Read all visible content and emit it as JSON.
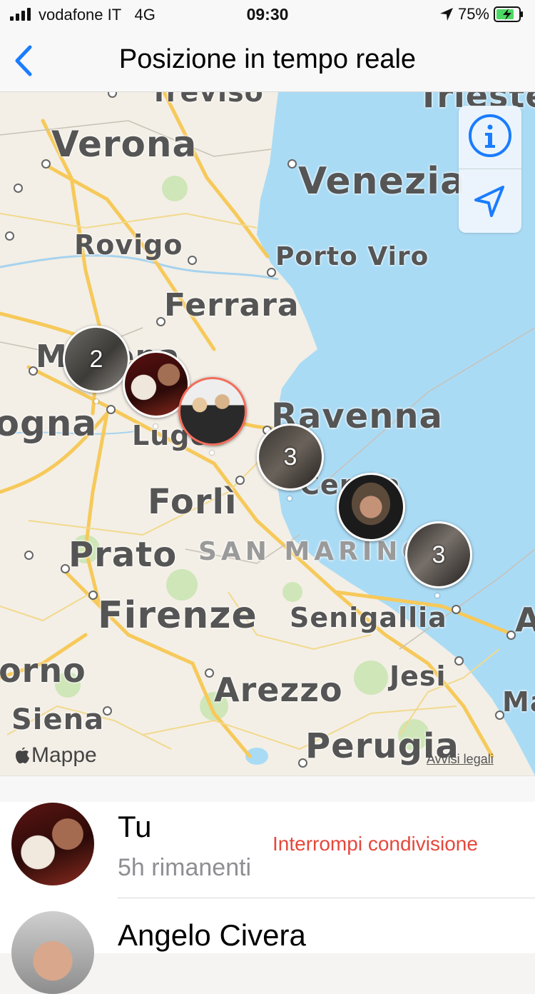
{
  "status": {
    "carrier": "vodafone IT",
    "network": "4G",
    "time": "09:30",
    "battery": "75%",
    "icons": [
      "signal-bars-icon",
      "location-arrow-icon",
      "battery-charging-icon"
    ]
  },
  "header": {
    "title": "Posizione in tempo reale",
    "back_icon": "chevron-left-icon"
  },
  "map": {
    "cities": [
      "Treviso",
      "Trieste",
      "Verona",
      "Venezia",
      "Rovigo",
      "Porto Viro",
      "Ferrara",
      "Modena",
      "Bologna",
      "Lugo",
      "Ravenna",
      "Cervia",
      "Forlì",
      "Prato",
      "SAN MARINO",
      "Firenze",
      "Senigallia",
      "Livorno",
      "Arezzo",
      "Jesi",
      "Siena",
      "Perugia",
      "Macerata",
      "Ancona"
    ],
    "clusters": [
      {
        "label": "2",
        "kind": "group"
      },
      {
        "label": "",
        "kind": "person"
      },
      {
        "label": "",
        "kind": "person"
      },
      {
        "label": "3",
        "kind": "group"
      },
      {
        "label": "",
        "kind": "person"
      },
      {
        "label": "3",
        "kind": "group"
      }
    ],
    "controls": [
      "info-icon",
      "location-arrow-icon"
    ],
    "brand": "Mappe",
    "legal": "Avvisi legali"
  },
  "people": [
    {
      "name": "Tu",
      "subtitle": "5h rimanenti",
      "action": "Interrompi condivisione"
    },
    {
      "name": "Angelo Civera"
    }
  ],
  "colors": {
    "accent": "#1a7cff",
    "destructive": "#e5483c",
    "sea": "#aadbf5",
    "land": "#f3efe6",
    "road": "#f6c95a"
  }
}
